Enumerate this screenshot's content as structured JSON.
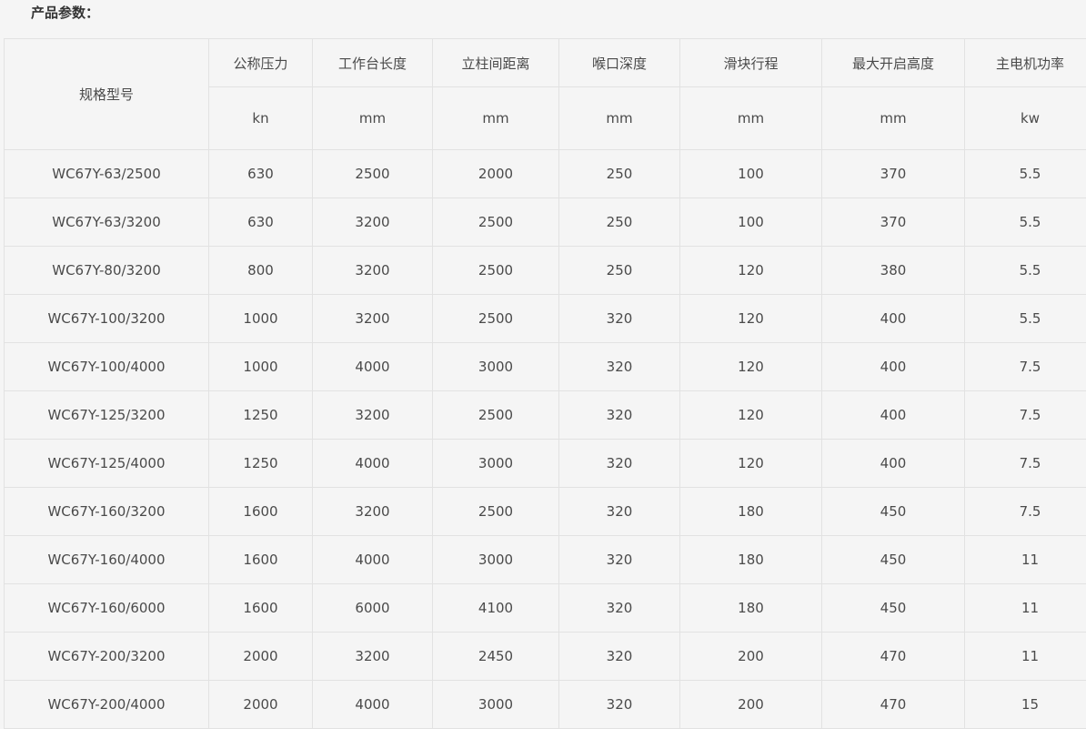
{
  "section_title": "产品参数：",
  "table": {
    "model_header": "规格型号",
    "headers": [
      "公称压力",
      "工作台长度",
      "立柱间距离",
      "喉口深度",
      "滑块行程",
      "最大开启高度",
      "主电机功率"
    ],
    "units": [
      "kn",
      "mm",
      "mm",
      "mm",
      "mm",
      "mm",
      "kw"
    ],
    "rows": [
      [
        "WC67Y-63/2500",
        "630",
        "2500",
        "2000",
        "250",
        "100",
        "370",
        "5.5"
      ],
      [
        "WC67Y-63/3200",
        "630",
        "3200",
        "2500",
        "250",
        "100",
        "370",
        "5.5"
      ],
      [
        "WC67Y-80/3200",
        "800",
        "3200",
        "2500",
        "250",
        "120",
        "380",
        "5.5"
      ],
      [
        "WC67Y-100/3200",
        "1000",
        "3200",
        "2500",
        "320",
        "120",
        "400",
        "5.5"
      ],
      [
        "WC67Y-100/4000",
        "1000",
        "4000",
        "3000",
        "320",
        "120",
        "400",
        "7.5"
      ],
      [
        "WC67Y-125/3200",
        "1250",
        "3200",
        "2500",
        "320",
        "120",
        "400",
        "7.5"
      ],
      [
        "WC67Y-125/4000",
        "1250",
        "4000",
        "3000",
        "320",
        "120",
        "400",
        "7.5"
      ],
      [
        "WC67Y-160/3200",
        "1600",
        "3200",
        "2500",
        "320",
        "180",
        "450",
        "7.5"
      ],
      [
        "WC67Y-160/4000",
        "1600",
        "4000",
        "3000",
        "320",
        "180",
        "450",
        "11"
      ],
      [
        "WC67Y-160/6000",
        "1600",
        "6000",
        "4100",
        "320",
        "180",
        "450",
        "11"
      ],
      [
        "WC67Y-200/3200",
        "2000",
        "3200",
        "2450",
        "320",
        "200",
        "470",
        "11"
      ],
      [
        "WC67Y-200/4000",
        "2000",
        "4000",
        "3000",
        "320",
        "200",
        "470",
        "15"
      ]
    ]
  }
}
